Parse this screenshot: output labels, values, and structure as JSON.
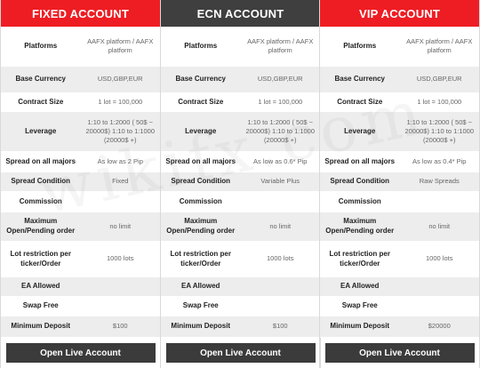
{
  "columns": [
    {
      "title": "FIXED ACCOUNT",
      "style": "red",
      "values": {
        "platforms": "AAFX platform / AAFX platform",
        "base_currency": "USD,GBP,EUR",
        "contract_size": "1 lot = 100,000",
        "leverage": "1:10 to 1:2000 ( 50$ ~ 20000$) 1:10 to 1:1000 (20000$ +)",
        "spread": "As low as 2 Pip",
        "spread_condition": "Fixed",
        "commission": "",
        "max_orders": "no limit",
        "lot_restriction": "1000 lots",
        "ea_allowed": "",
        "swap_free": "",
        "min_deposit": "$100"
      },
      "button": "Open Live Account"
    },
    {
      "title": "ECN ACCOUNT",
      "style": "dark",
      "values": {
        "platforms": "AAFX platform / AAFX platform",
        "base_currency": "USD,GBP,EUR",
        "contract_size": "1 lot = 100,000",
        "leverage": "1:10 to 1:2000 ( 50$ ~ 20000$) 1:10 to 1:1000 (20000$ +)",
        "spread": "As low as 0.6* Pip",
        "spread_condition": "Variable Plus",
        "commission": "",
        "max_orders": "no limit",
        "lot_restriction": "1000 lots",
        "ea_allowed": "",
        "swap_free": "",
        "min_deposit": "$100"
      },
      "button": "Open Live Account"
    },
    {
      "title": "VIP ACCOUNT",
      "style": "red",
      "values": {
        "platforms": "AAFX platform / AAFX platform",
        "base_currency": "USD,GBP,EUR",
        "contract_size": "1 lot = 100,000",
        "leverage": "1:10 to 1:2000 ( 50$ ~ 20000$) 1:10 to 1:1000 (20000$ +)",
        "spread": "As low as 0.4* Pip",
        "spread_condition": "Raw Spreads",
        "commission": "",
        "max_orders": "no limit",
        "lot_restriction": "1000 lots",
        "ea_allowed": "",
        "swap_free": "",
        "min_deposit": "$20000"
      },
      "button": "Open Live Account"
    }
  ],
  "labels": {
    "platforms": "Platforms",
    "base_currency": "Base Currency",
    "contract_size": "Contract Size",
    "leverage": "Leverage",
    "spread": "Spread on all majors",
    "spread_condition": "Spread Condition",
    "commission": "Commission",
    "max_orders": "Maximum Open/Pending order",
    "lot_restriction": "Lot restriction per ticker/Order",
    "ea_allowed": "EA Allowed",
    "swap_free": "Swap Free",
    "min_deposit": "Minimum Deposit"
  },
  "watermark": "wikifx.com",
  "colors": {
    "red": "#ee1d23",
    "dark": "#3f3f3f",
    "row_grey": "#ededed",
    "button": "#3b3b3b"
  }
}
